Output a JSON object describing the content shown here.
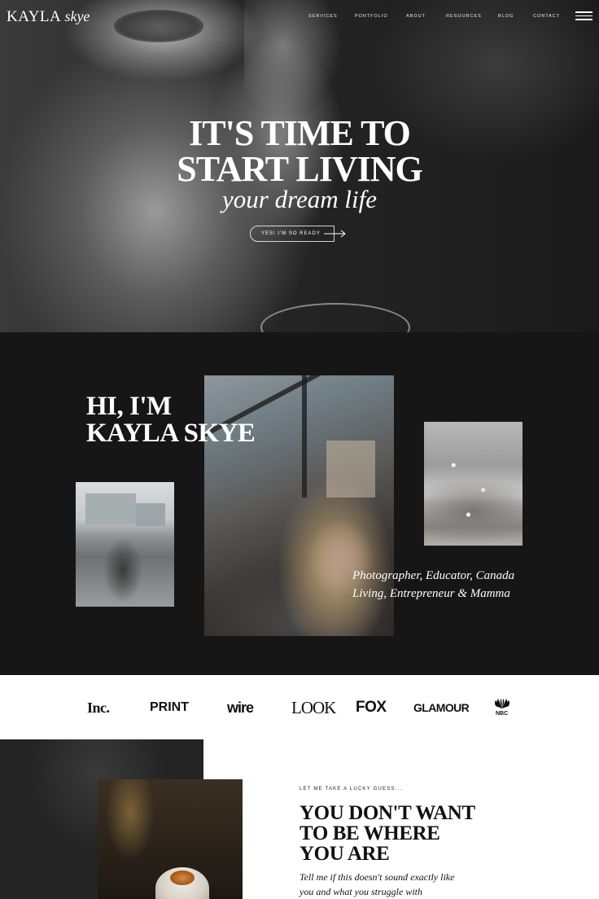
{
  "header": {
    "logo_main": "KAYLA",
    "logo_script": "skye",
    "nav": [
      "SERVICES",
      "PORTFOLIO",
      "ABOUT",
      "RESOURCES",
      "BLOG",
      "CONTACT"
    ]
  },
  "hero": {
    "title_line1": "IT'S TIME TO",
    "title_line2": "START LIVING",
    "script": "your dream life",
    "cta_label": "YES! I'M SO READY"
  },
  "about": {
    "title_line1": "HI, I'M",
    "title_line2": "KAYLA SKYE",
    "caption": "Photographer, Educator, Canada Living, Entrepreneur & Mamma"
  },
  "press": {
    "logos": [
      "Inc.",
      "PRINT",
      "wire",
      "LOOK",
      "FOX",
      "GLAMOUR",
      "NBC"
    ]
  },
  "guess": {
    "eyebrow": "LET ME TAKE A LUCKY GUESS...",
    "title_line1": "YOU DON'T WANT",
    "title_line2": "TO BE WHERE",
    "title_line3": "YOU ARE",
    "body": "Tell me if this doesn't sound exactly like you and what you struggle with"
  },
  "colors": {
    "dark_bg": "#161616",
    "light_bg": "#ffffff",
    "text_light": "#ffffff",
    "text_dark": "#111111"
  }
}
